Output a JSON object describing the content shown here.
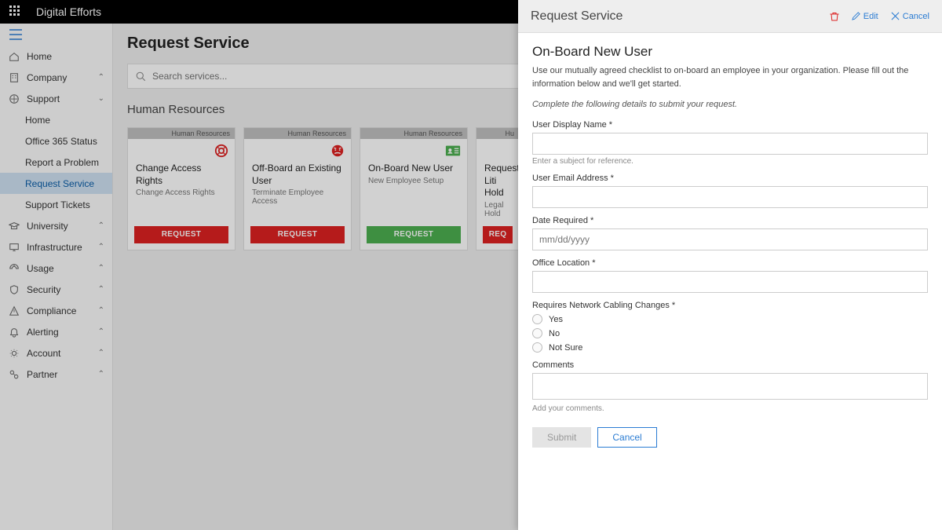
{
  "brand": "Digital Efforts",
  "sidebar": {
    "items": [
      {
        "label": "Home",
        "icon": "home"
      },
      {
        "label": "Company",
        "icon": "company",
        "expandable": true
      },
      {
        "label": "Support",
        "icon": "support",
        "expandable": true,
        "expanded": true,
        "children": [
          {
            "label": "Home"
          },
          {
            "label": "Office 365 Status"
          },
          {
            "label": "Report a Problem"
          },
          {
            "label": "Request Service",
            "active": true
          },
          {
            "label": "Support Tickets"
          }
        ]
      },
      {
        "label": "University",
        "icon": "university",
        "expandable": true
      },
      {
        "label": "Infrastructure",
        "icon": "infra",
        "expandable": true
      },
      {
        "label": "Usage",
        "icon": "usage",
        "expandable": true
      },
      {
        "label": "Security",
        "icon": "security",
        "expandable": true
      },
      {
        "label": "Compliance",
        "icon": "compliance",
        "expandable": true
      },
      {
        "label": "Alerting",
        "icon": "alerting",
        "expandable": true
      },
      {
        "label": "Account",
        "icon": "account",
        "expandable": true
      },
      {
        "label": "Partner",
        "icon": "partner",
        "expandable": true
      }
    ]
  },
  "page": {
    "title": "Request Service",
    "search_placeholder": "Search services...",
    "section": "Human Resources"
  },
  "cards": [
    {
      "category": "Human Resources",
      "icon": "life-ring",
      "icon_color": "#d22",
      "title": "Change Access Rights",
      "subtitle": "Change Access Rights",
      "btn": "REQUEST",
      "btn_color": "red"
    },
    {
      "category": "Human Resources",
      "icon": "face-angry",
      "icon_color": "#d22",
      "title": "Off-Board an Existing User",
      "subtitle": "Terminate Employee Access",
      "btn": "REQUEST",
      "btn_color": "red"
    },
    {
      "category": "Human Resources",
      "icon": "id-card",
      "icon_color": "#4caf50",
      "title": "On-Board New User",
      "subtitle": "New Employee Setup",
      "btn": "REQUEST",
      "btn_color": "green"
    },
    {
      "category": "Human Resources",
      "icon": "",
      "icon_color": "",
      "title": "Request Litigation Hold",
      "subtitle": "Legal Hold",
      "btn": "REQUEST",
      "btn_color": "red"
    }
  ],
  "panel": {
    "header_title": "Request Service",
    "actions": {
      "edit": "Edit",
      "cancel": "Cancel"
    },
    "form_title": "On-Board New User",
    "form_desc": "Use our mutually agreed checklist to on-board an employee in your organization. Please fill out the information below and we'll get started.",
    "form_instr": "Complete the following details to submit your request.",
    "fields": {
      "display_name": {
        "label": "User Display Name *",
        "hint": "Enter a subject for reference."
      },
      "email": {
        "label": "User Email Address *"
      },
      "date": {
        "label": "Date Required *",
        "placeholder": "mm/dd/yyyy"
      },
      "office": {
        "label": "Office Location *"
      },
      "cabling": {
        "label": "Requires Network Cabling Changes *",
        "options": [
          "Yes",
          "No",
          "Not Sure"
        ]
      },
      "comments": {
        "label": "Comments",
        "hint": "Add your comments."
      }
    },
    "buttons": {
      "submit": "Submit",
      "cancel": "Cancel"
    }
  }
}
